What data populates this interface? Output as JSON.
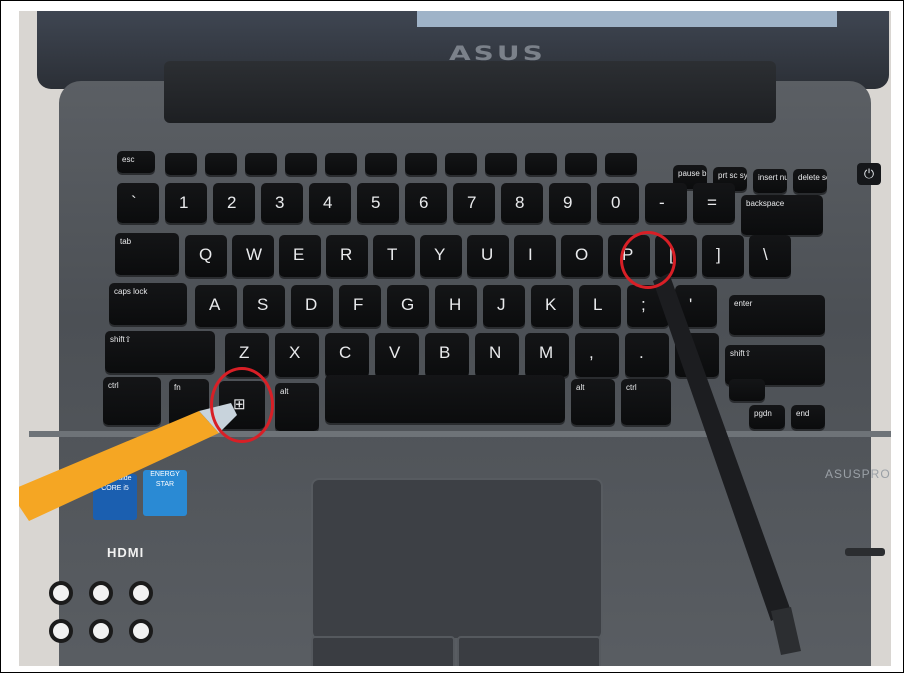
{
  "photo": {
    "subject": "ASUS laptop keyboard with Windows and P keys circled in red",
    "lid_logo": "ASUS",
    "brand_text": "ASUSPRO",
    "stickers": {
      "intel": "intel inside CORE i5",
      "energy_star": "ENERGY STAR"
    },
    "port_label": "HDMI",
    "highlighted_keys": [
      "windows",
      "P"
    ],
    "annotation_color": "#d81f26",
    "pointer_left": "orange pen",
    "pointer_right": "black pen"
  },
  "keys": {
    "esc": "esc",
    "pause": "pause break",
    "prtsc": "prt sc sysrq",
    "insert": "insert num lk",
    "delete": "delete scr lk",
    "row1": [
      "`",
      "1",
      "2",
      "3",
      "4",
      "5",
      "6",
      "7",
      "8",
      "9",
      "0",
      "-",
      "="
    ],
    "backspace": "backspace",
    "tab": "tab",
    "row2": [
      "Q",
      "W",
      "E",
      "R",
      "T",
      "Y",
      "U",
      "I",
      "O",
      "P",
      "[",
      "]",
      "\\"
    ],
    "caps": "caps lock",
    "row3": [
      "A",
      "S",
      "D",
      "F",
      "G",
      "H",
      "J",
      "K",
      "L",
      ";",
      "'"
    ],
    "enter": "enter",
    "shift_l": "shift⇧",
    "row4": [
      "Z",
      "X",
      "C",
      "V",
      "B",
      "N",
      "M",
      ",",
      ".",
      "/"
    ],
    "shift_r": "shift⇧",
    "ctrl_l": "ctrl",
    "fn": "fn",
    "alt_l": "alt",
    "alt_r": "alt",
    "ctrl_r": "ctrl",
    "pgup": "pgup",
    "pgdn": "pgdn",
    "end": "end"
  }
}
